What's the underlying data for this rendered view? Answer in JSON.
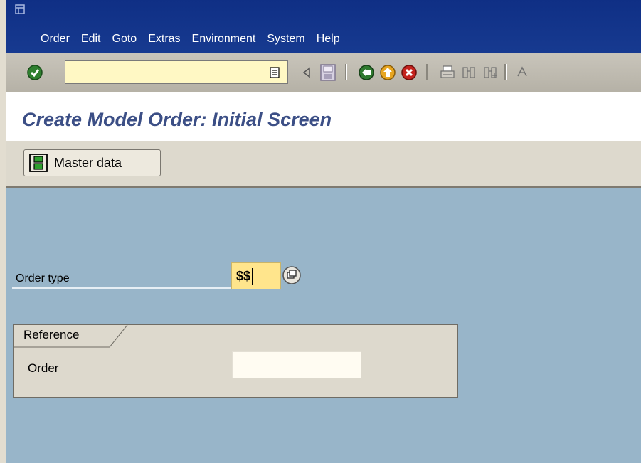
{
  "menu": {
    "items": [
      "Order",
      "Edit",
      "Goto",
      "Extras",
      "Environment",
      "System",
      "Help"
    ],
    "underline": [
      "O",
      "E",
      "G",
      "t",
      "n",
      "y",
      "H"
    ]
  },
  "toolbar": {
    "command_field_value": "",
    "icons": [
      "enter-icon",
      "command-field",
      "save-icon",
      "back-icon",
      "exit-icon",
      "cancel-icon",
      "print-icon",
      "find-icon",
      "find-next-icon",
      "first-page-icon"
    ]
  },
  "title": "Create Model Order: Initial Screen",
  "app_toolbar": {
    "master_data_label": "Master data"
  },
  "fields": {
    "order_type_label": "Order type",
    "order_type_value": "$$"
  },
  "reference": {
    "group_title": "Reference",
    "order_label": "Order",
    "order_value": ""
  },
  "colors": {
    "menubar": "#0f2f85",
    "background": "#98b5c9",
    "title_text": "#3c4f86",
    "required_field": "#ffe58c"
  }
}
